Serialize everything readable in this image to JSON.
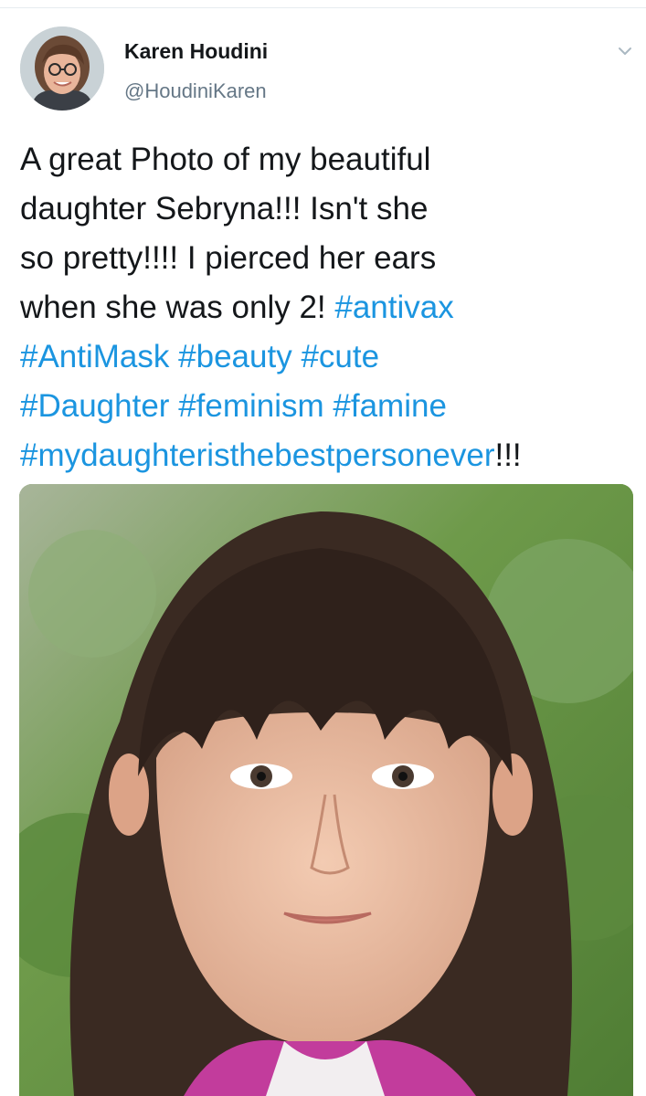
{
  "tweet": {
    "author": {
      "name": "Karen Houdini",
      "handle": "@HoudiniKaren",
      "avatar_icon": "profile-photo-woman-glasses"
    },
    "menu_icon": "chevron-down-icon",
    "text_lines": [
      [
        {
          "t": "A great Photo of my beautiful",
          "tag": false
        }
      ],
      [
        {
          "t": "daughter Sebryna!!! Isn't she",
          "tag": false
        }
      ],
      [
        {
          "t": "so pretty!!!! I pierced her ears",
          "tag": false
        }
      ],
      [
        {
          "t": "when she was only 2! ",
          "tag": false
        },
        {
          "t": "#antivax",
          "tag": true
        }
      ],
      [
        {
          "t": "#AntiMask",
          "tag": true
        },
        {
          "t": " ",
          "tag": false
        },
        {
          "t": "#beauty",
          "tag": true
        },
        {
          "t": " ",
          "tag": false
        },
        {
          "t": "#cute",
          "tag": true
        }
      ],
      [
        {
          "t": "#Daughter",
          "tag": true
        },
        {
          "t": " ",
          "tag": false
        },
        {
          "t": "#feminism",
          "tag": true
        },
        {
          "t": " ",
          "tag": false
        },
        {
          "t": "#famine",
          "tag": true
        }
      ],
      [
        {
          "t": "#mydaughteristhebestpersonever",
          "tag": true
        },
        {
          "t": "!!!",
          "tag": false
        }
      ]
    ],
    "media_icon": "photo-child-portrait"
  },
  "colors": {
    "text": "#14171a",
    "secondary": "#657786",
    "link": "#1b95e0",
    "divider": "#e6ecf0"
  }
}
